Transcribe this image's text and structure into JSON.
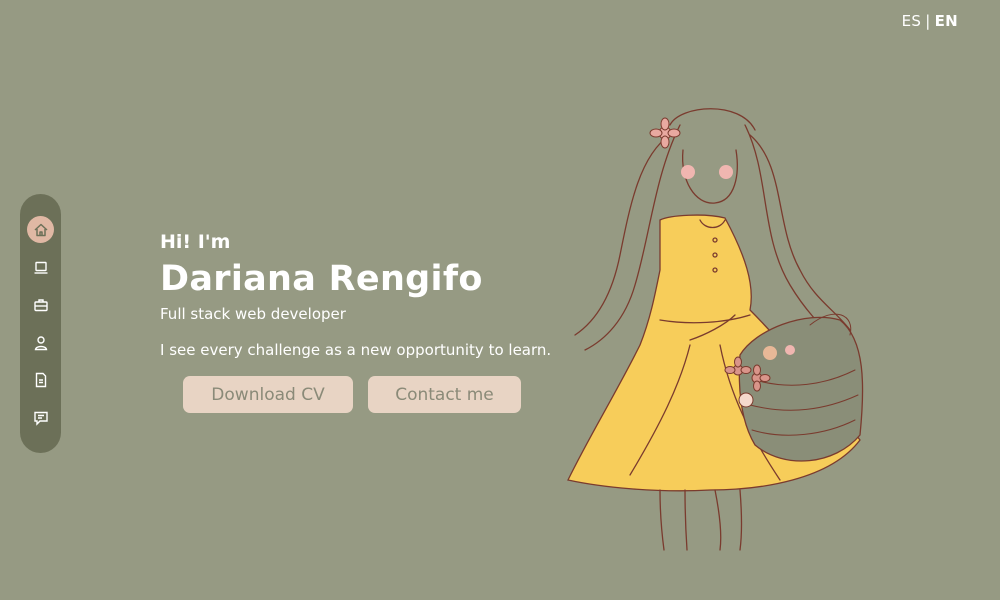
{
  "lang": {
    "es": "ES",
    "separator": "|",
    "en": "EN"
  },
  "nav": {
    "icons": [
      "home-icon",
      "laptop-icon",
      "briefcase-icon",
      "user-icon",
      "document-icon",
      "chat-icon"
    ]
  },
  "hero": {
    "greeting": "Hi! I'm",
    "name": "Dariana Rengifo",
    "role": "Full stack web developer",
    "motto": "I see every challenge as a new opportunity to learn."
  },
  "buttons": {
    "download_cv": "Download CV",
    "contact": "Contact me"
  },
  "colors": {
    "background": "#969a83",
    "sidebar": "#6c7058",
    "accent": "#e0b8a4",
    "button": "#e8d4c4",
    "dress": "#f7cd5a"
  }
}
